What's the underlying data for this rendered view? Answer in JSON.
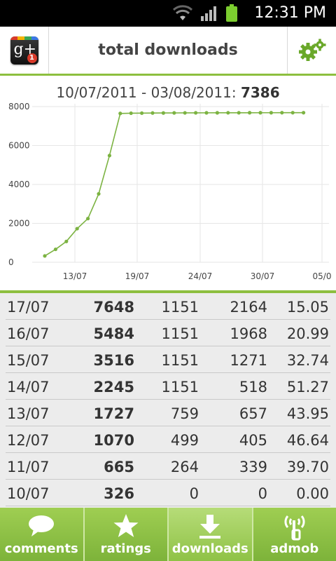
{
  "status_bar": {
    "time": "12:31 PM"
  },
  "header": {
    "title": "total downloads",
    "logo_text": "g+",
    "logo_badge": "1"
  },
  "chart": {
    "date_range": "10/07/2011 - 03/08/2011: ",
    "total": "7386"
  },
  "chart_data": {
    "type": "line",
    "title": "10/07/2011 - 03/08/2011: 7386",
    "xlabel": "",
    "ylabel": "",
    "x_tick_labels": [
      "13/07",
      "19/07",
      "24/07",
      "30/07",
      "05/0"
    ],
    "y_tick_labels": [
      "0",
      "2000",
      "4000",
      "6000",
      "8000"
    ],
    "ylim": [
      0,
      8000
    ],
    "grid": true,
    "series": [
      {
        "x": [
          "10/07",
          "11/07",
          "12/07",
          "13/07",
          "14/07",
          "15/07",
          "16/07",
          "17/07",
          "18/07",
          "19/07",
          "20/07",
          "21/07",
          "22/07",
          "23/07",
          "24/07",
          "25/07",
          "26/07",
          "27/07",
          "28/07",
          "29/07",
          "30/07",
          "31/07",
          "01/08",
          "02/08",
          "03/08"
        ],
        "values": [
          326,
          665,
          1070,
          1727,
          2245,
          3516,
          5484,
          7648,
          7660,
          7665,
          7670,
          7672,
          7675,
          7677,
          7679,
          7680,
          7681,
          7682,
          7683,
          7684,
          7685,
          7685,
          7686,
          7686,
          7686
        ]
      }
    ],
    "color": "#7cb342"
  },
  "table": {
    "rows": [
      {
        "date": "17/07",
        "total": "7648",
        "a": "1151",
        "b": "2164",
        "c": "15.05"
      },
      {
        "date": "16/07",
        "total": "5484",
        "a": "1151",
        "b": "1968",
        "c": "20.99"
      },
      {
        "date": "15/07",
        "total": "3516",
        "a": "1151",
        "b": "1271",
        "c": "32.74"
      },
      {
        "date": "14/07",
        "total": "2245",
        "a": "1151",
        "b": "518",
        "c": "51.27"
      },
      {
        "date": "13/07",
        "total": "1727",
        "a": "759",
        "b": "657",
        "c": "43.95"
      },
      {
        "date": "12/07",
        "total": "1070",
        "a": "499",
        "b": "405",
        "c": "46.64"
      },
      {
        "date": "11/07",
        "total": "665",
        "a": "264",
        "b": "339",
        "c": "39.70"
      },
      {
        "date": "10/07",
        "total": "326",
        "a": "0",
        "b": "0",
        "c": "0.00"
      }
    ]
  },
  "bottom_nav": {
    "tabs": [
      {
        "label": "comments",
        "icon": "speech-bubble-icon"
      },
      {
        "label": "ratings",
        "icon": "star-icon"
      },
      {
        "label": "downloads",
        "icon": "download-arrow-icon"
      },
      {
        "label": "admob",
        "icon": "antenna-icon"
      }
    ],
    "active_index": 2
  },
  "colors": {
    "accent": "#8dbf3f",
    "line": "#7cb342",
    "tab_bar": "#8fc246"
  }
}
